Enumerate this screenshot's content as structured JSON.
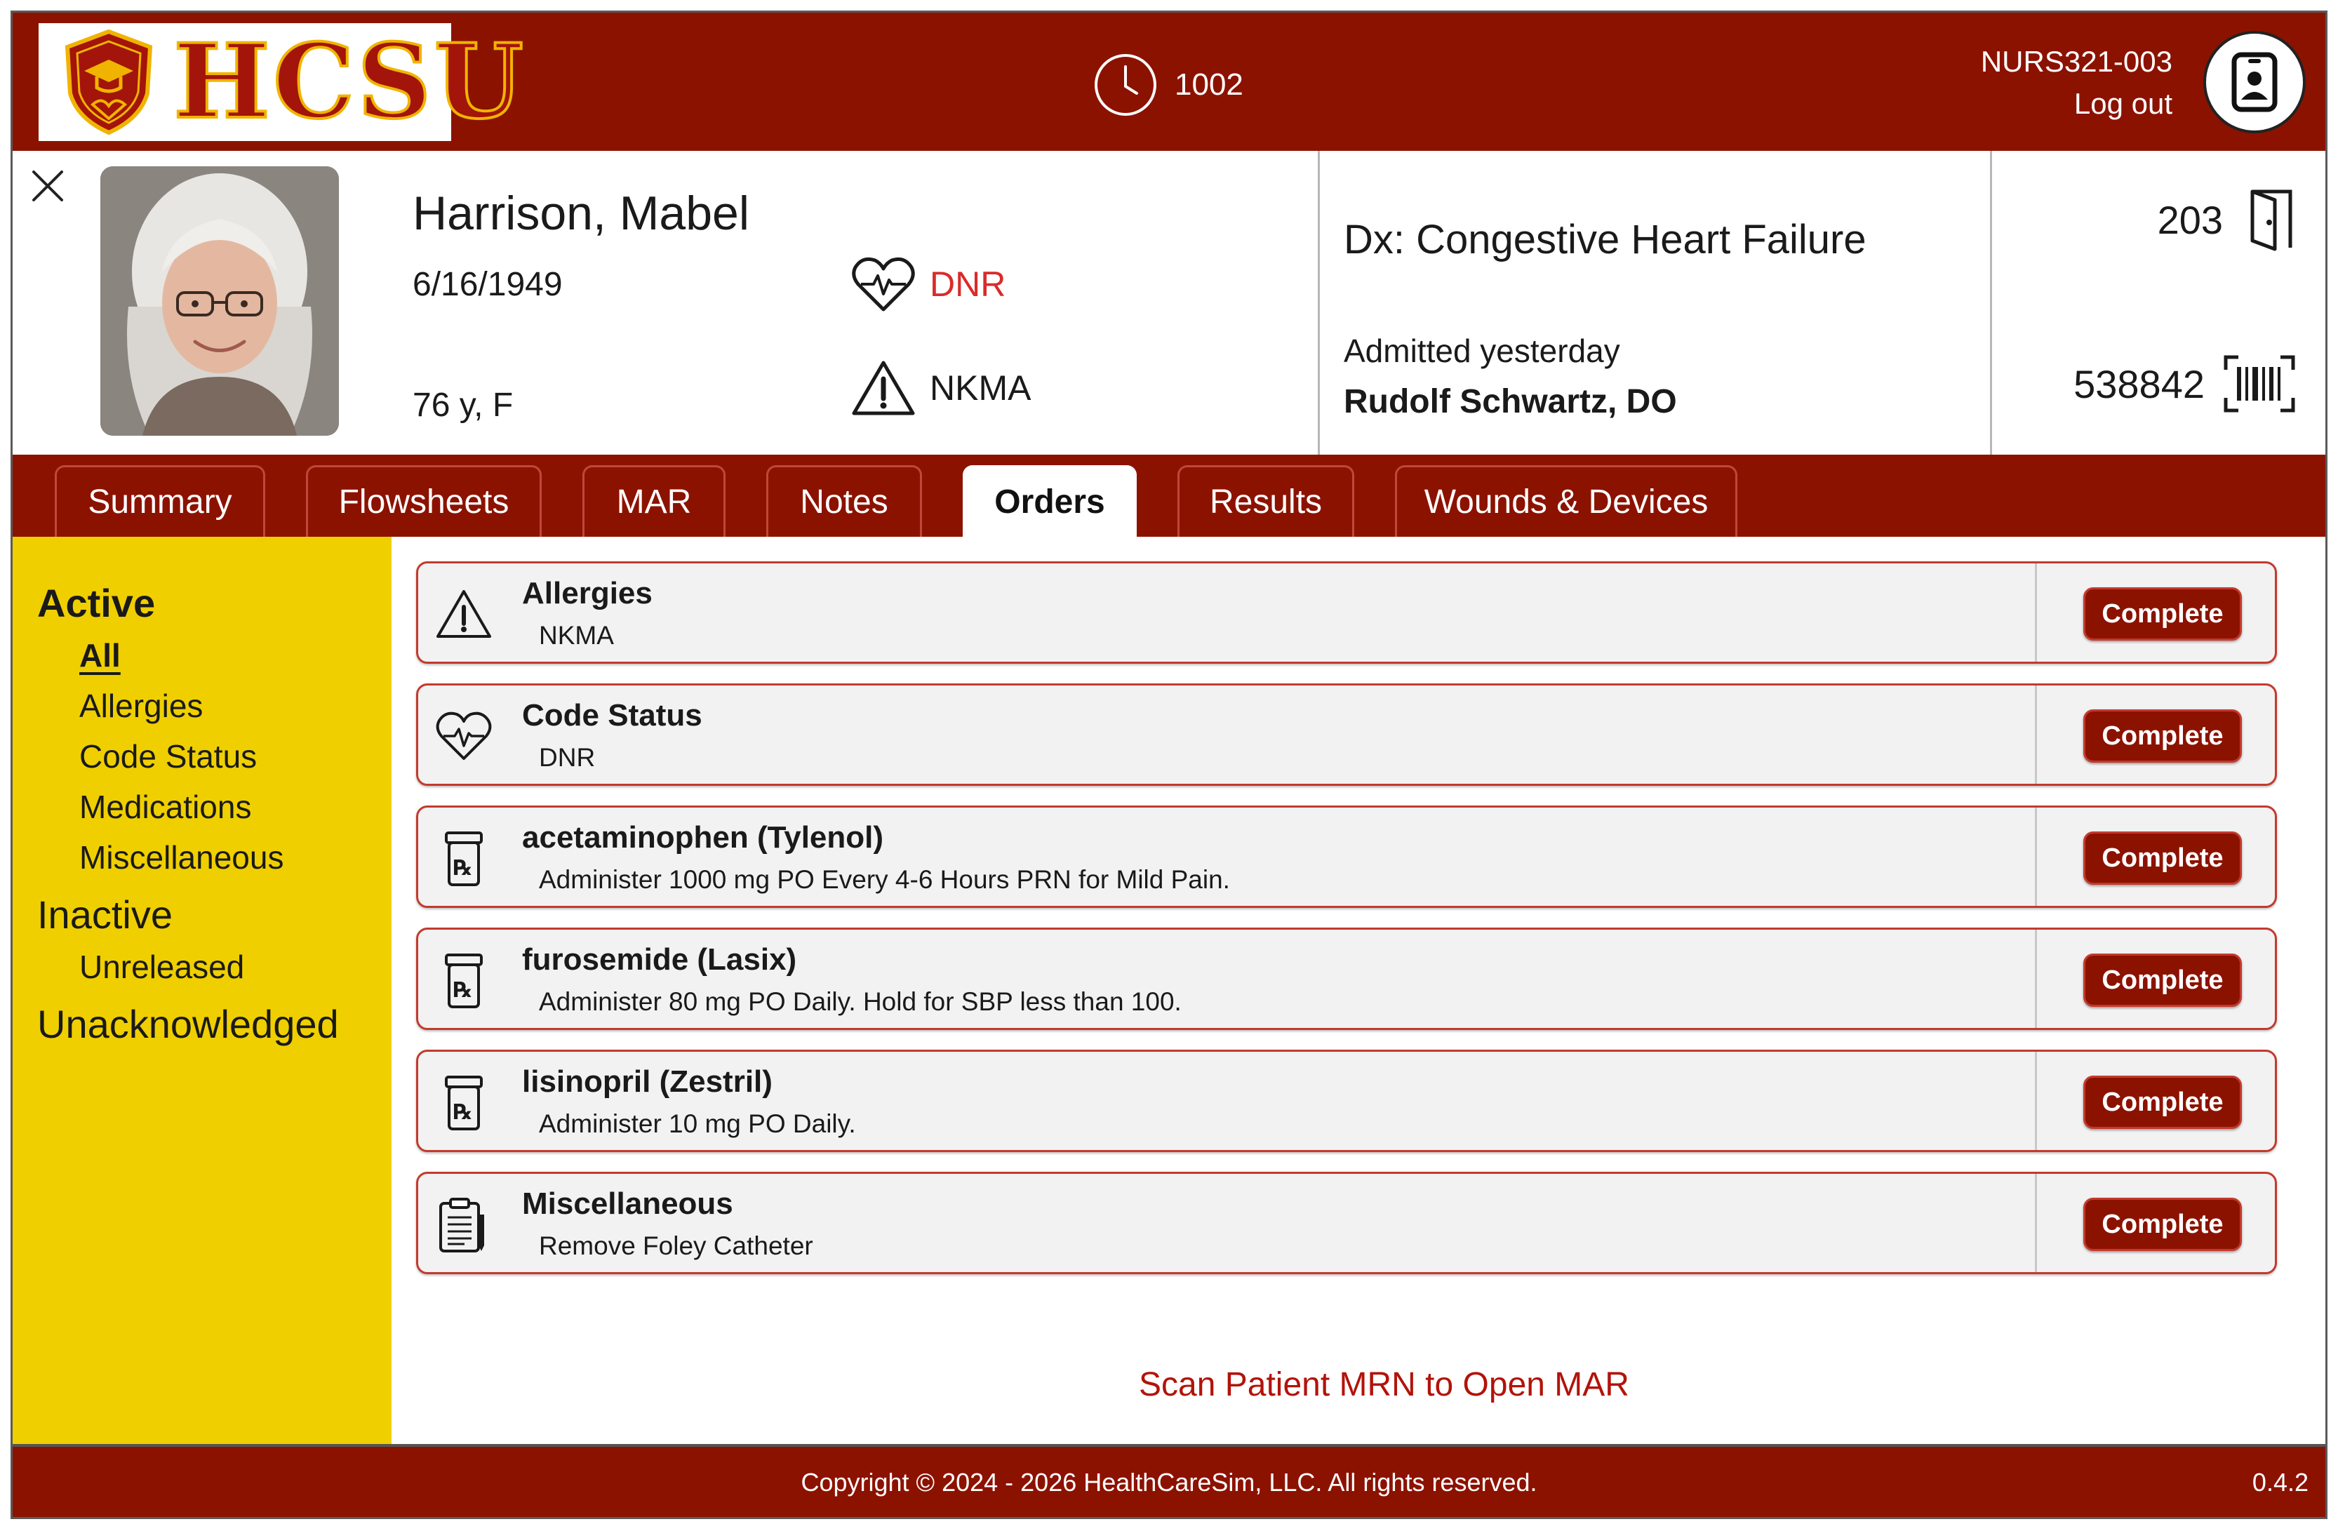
{
  "header": {
    "logo_text": "HCSU",
    "clock_value": "1002",
    "user_course": "NURS321-003",
    "logout_label": "Log out"
  },
  "patient": {
    "name": "Harrison, Mabel",
    "dob": "6/16/1949",
    "age_sex": "76 y, F",
    "code_status": "DNR",
    "allergy_status": "NKMA",
    "diagnosis": "Dx: Congestive Heart Failure",
    "admitted": "Admitted yesterday",
    "provider": "Rudolf Schwartz, DO",
    "room": "203",
    "mrn": "538842"
  },
  "tabs": [
    {
      "label": "Summary"
    },
    {
      "label": "Flowsheets"
    },
    {
      "label": "MAR"
    },
    {
      "label": "Notes"
    },
    {
      "label": "Orders",
      "active": true
    },
    {
      "label": "Results"
    },
    {
      "label": "Wounds & Devices"
    }
  ],
  "nav": {
    "active": "Active",
    "active_items": [
      "All",
      "Allergies",
      "Code Status",
      "Medications",
      "Miscellaneous"
    ],
    "inactive": "Inactive",
    "inactive_items": [
      "Unreleased"
    ],
    "unacknowledged": "Unacknowledged"
  },
  "orders": [
    {
      "icon": "warning-icon",
      "title": "Allergies",
      "detail": "NKMA",
      "button": "Complete"
    },
    {
      "icon": "heart-pulse-icon",
      "title": "Code Status",
      "detail": "DNR",
      "button": "Complete"
    },
    {
      "icon": "prescription-bottle-icon",
      "title": "acetaminophen (Tylenol)",
      "detail": "Administer 1000 mg PO Every 4-6 Hours PRN for Mild Pain.",
      "button": "Complete"
    },
    {
      "icon": "prescription-bottle-icon",
      "title": "furosemide (Lasix)",
      "detail": "Administer 80 mg PO Daily. Hold for SBP less than 100.",
      "button": "Complete"
    },
    {
      "icon": "prescription-bottle-icon",
      "title": "lisinopril (Zestril)",
      "detail": "Administer 10 mg PO Daily.",
      "button": "Complete"
    },
    {
      "icon": "clipboard-icon",
      "title": "Miscellaneous",
      "detail": "Remove Foley Catheter",
      "button": "Complete"
    }
  ],
  "scan_message": "Scan Patient MRN to Open MAR",
  "footer": {
    "copyright": "Copyright © 2024 - 2026 HealthCareSim, LLC. All rights reserved.",
    "version": "0.4.2"
  },
  "colors": {
    "brand_red": "#8c1200",
    "nav_yellow": "#f0cf00",
    "alert_red": "#d92b2b"
  }
}
